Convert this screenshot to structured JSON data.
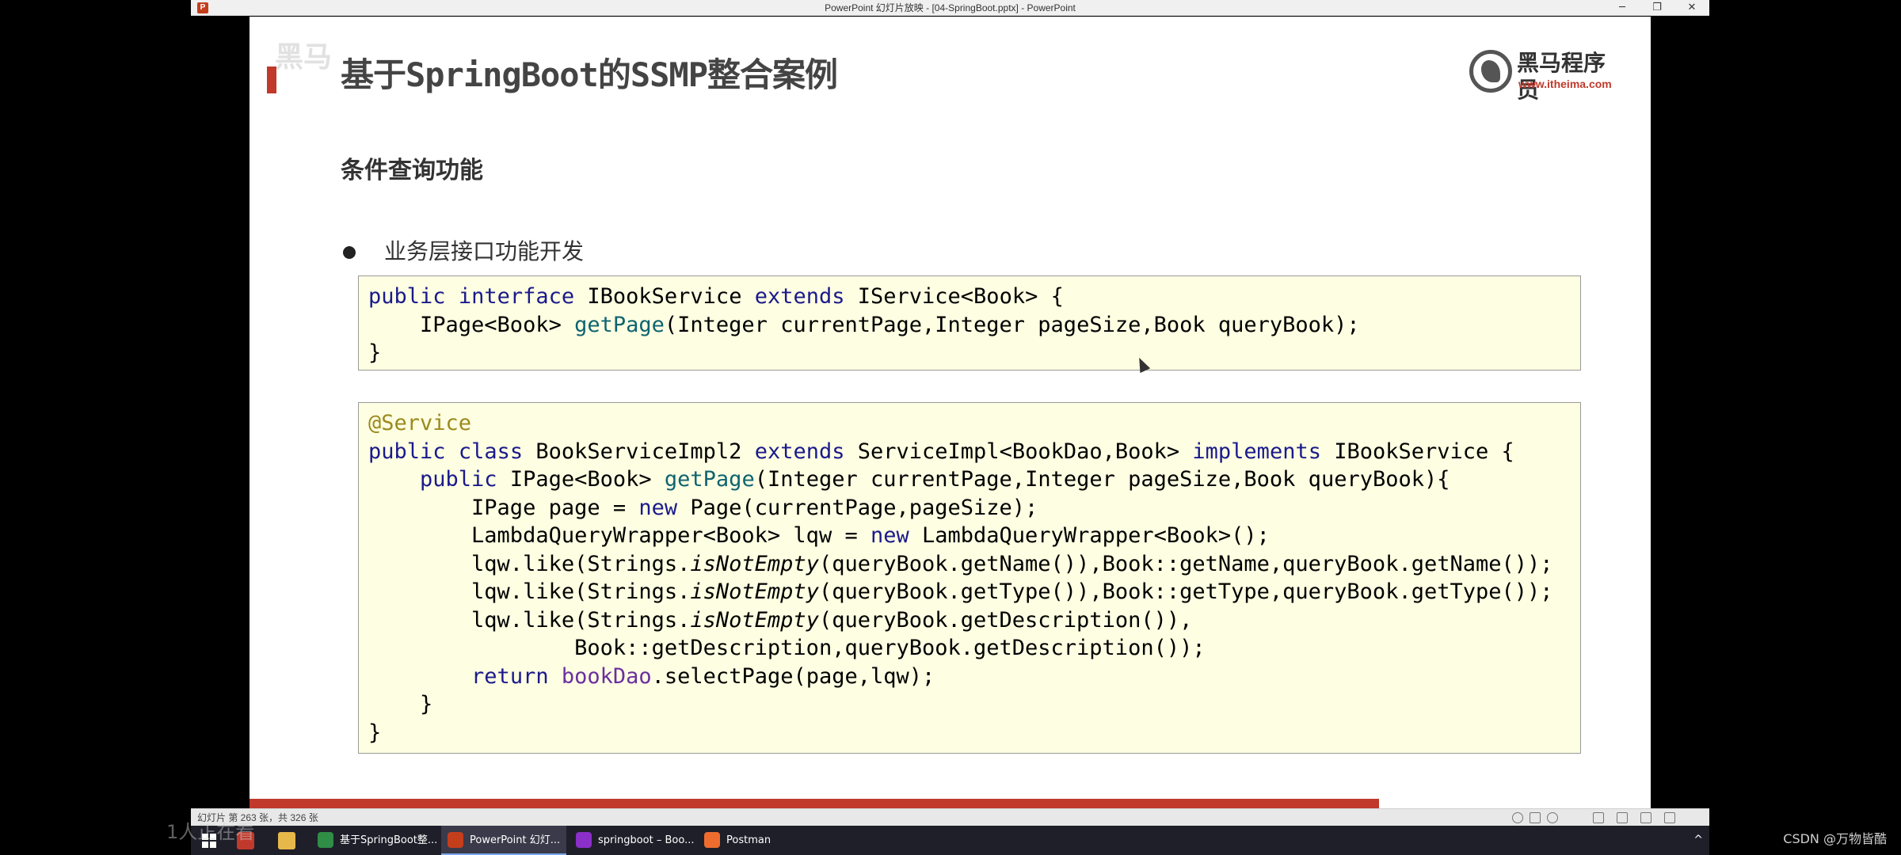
{
  "window": {
    "title": "PowerPoint 幻灯片放映 - [04-SpringBoot.pptx] - PowerPoint",
    "app_icon": "P",
    "minimize": "─",
    "restore": "❐",
    "close": "✕"
  },
  "slide": {
    "watermark": "黑马",
    "title": "基于SpringBoot的SSMP整合案例",
    "logo_name": "黑马程序员",
    "logo_url": "www.itheima.com",
    "section": "条件查询功能",
    "bullet": "业务层接口功能开发",
    "code1": [
      "public interface IBookService extends IService<Book> {",
      "    IPage<Book> getPage(Integer currentPage,Integer pageSize,Book queryBook);",
      "}"
    ],
    "code2": [
      "@Service",
      "public class BookServiceImpl2 extends ServiceImpl<BookDao,Book> implements IBookService {",
      "    public IPage<Book> getPage(Integer currentPage,Integer pageSize,Book queryBook){",
      "        IPage page = new Page(currentPage,pageSize);",
      "        LambdaQueryWrapper<Book> lqw = new LambdaQueryWrapper<Book>();",
      "        lqw.like(Strings.isNotEmpty(queryBook.getName()),Book::getName,queryBook.getName());",
      "        lqw.like(Strings.isNotEmpty(queryBook.getType()),Book::getType,queryBook.getType());",
      "        lqw.like(Strings.isNotEmpty(queryBook.getDescription()),",
      "                Book::getDescription,queryBook.getDescription());",
      "        return bookDao.selectPage(page,lqw);",
      "    }",
      "}"
    ],
    "progress": 0.806
  },
  "statusbar": {
    "slide_info": "幻灯片 第 263 张，共 326 张"
  },
  "taskbar": {
    "apps": [
      {
        "label": "基于SpringBoot整...",
        "color": "#2f8d46"
      },
      {
        "label": "PowerPoint 幻灯...",
        "color": "#c43e1c"
      },
      {
        "label": "springboot – Boo...",
        "color": "#8b2fc9"
      },
      {
        "label": "Postman",
        "color": "#ef6c2f"
      }
    ],
    "tray_chevron": "^"
  },
  "overlay": {
    "live_text": "1人正在看",
    "csdn": "CSDN @万物皆酷"
  },
  "colors": {
    "accent": "#c0392b",
    "code_bg": "#fefee2",
    "keyword": "#1a1a8c",
    "method": "#0e6470",
    "annotation": "#9b8a1e",
    "field": "#6b2fa0"
  }
}
